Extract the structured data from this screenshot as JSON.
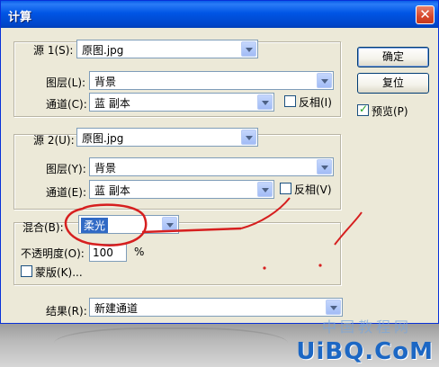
{
  "window": {
    "title": "计算",
    "close_glyph": "✕"
  },
  "source1": {
    "label": "源 1(S):",
    "file": "原图.jpg",
    "layer_label": "图层(L):",
    "layer": "背景",
    "channel_label": "通道(C):",
    "channel": "蓝 副本",
    "invert_label": "反相(I)"
  },
  "source2": {
    "label": "源 2(U):",
    "file": "原图.jpg",
    "layer_label": "图层(Y):",
    "layer": "背景",
    "channel_label": "通道(E):",
    "channel": "蓝 副本",
    "invert_label": "反相(V)"
  },
  "blend": {
    "label": "混合(B):",
    "mode": "柔光",
    "opacity_label": "不透明度(O):",
    "opacity": "100",
    "percent": "%",
    "mask_label": "蒙版(K)..."
  },
  "result": {
    "label": "结果(R):",
    "value": "新建通道"
  },
  "buttons": {
    "ok": "确定",
    "reset": "复位",
    "preview_label": "预览(P)",
    "preview_checked": true
  },
  "watermark": {
    "main": "UiBQ.CoM",
    "sub": "中国教程网"
  },
  "colors": {
    "annotation": "#d61f1f",
    "title_bar": "#0055e5",
    "dialog_bg": "#ece9d8"
  }
}
